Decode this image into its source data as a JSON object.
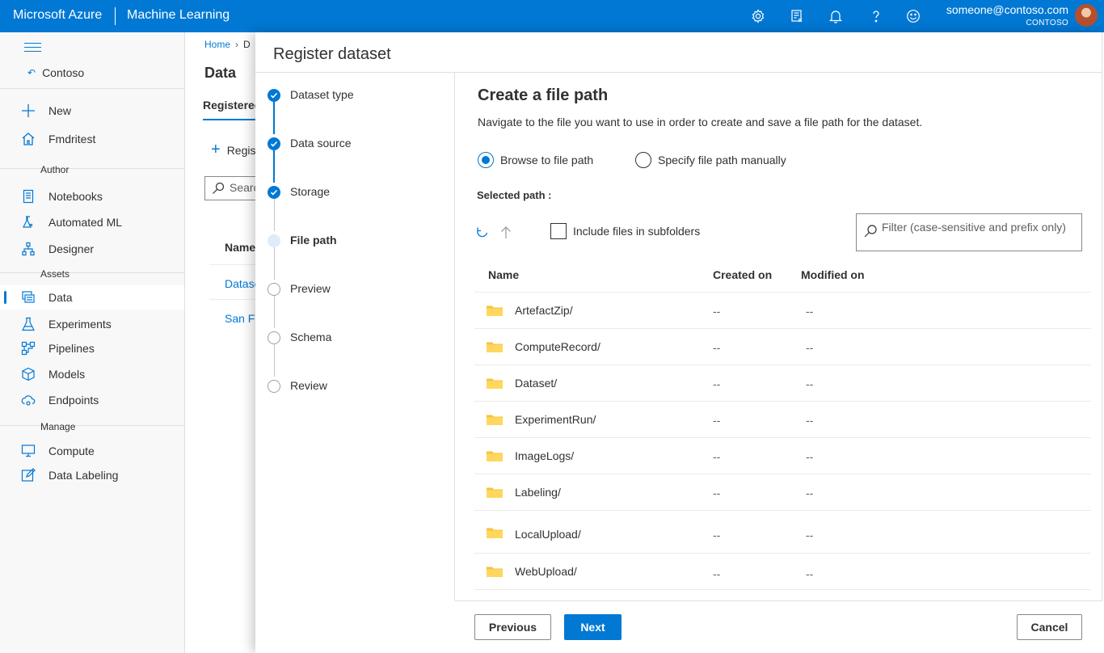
{
  "topbar": {
    "brand": "Microsoft Azure",
    "product": "Machine Learning",
    "icons": [
      "settings-icon",
      "feedback-icon",
      "notifications-icon",
      "help-icon",
      "smiley-icon"
    ],
    "user_email": "someone@contoso.com",
    "user_tenant": "CONTOSO",
    "accent_color": "#0078d4"
  },
  "sidebar": {
    "workspace": "Contoso",
    "top_items": [
      {
        "label": "New",
        "icon": "plus-icon"
      },
      {
        "label": "Fmdritest",
        "icon": "home-icon"
      }
    ],
    "sections": {
      "author": "Author",
      "assets": "Assets",
      "manage": "Manage"
    },
    "author_items": [
      {
        "label": "Notebooks",
        "icon": "notebook-icon"
      },
      {
        "label": "Automated ML",
        "icon": "flask-icon"
      },
      {
        "label": "Designer",
        "icon": "designer-icon"
      }
    ],
    "assets_items": [
      {
        "label": "Data",
        "icon": "data-icon",
        "active": true
      },
      {
        "label": "Experiments",
        "icon": "experiment-icon"
      },
      {
        "label": "Pipelines",
        "icon": "pipeline-icon"
      },
      {
        "label": "Models",
        "icon": "cube-icon"
      },
      {
        "label": "Endpoints",
        "icon": "endpoint-icon"
      }
    ],
    "manage_items": [
      {
        "label": "Compute",
        "icon": "monitor-icon"
      },
      {
        "label": "Data Labeling",
        "icon": "edit-icon"
      }
    ]
  },
  "page": {
    "breadcrumb_home": "Home",
    "breadcrumb_next": "D",
    "title": "Data",
    "tab": "Registered",
    "register_label": "Regis",
    "search_placeholder": "Searc",
    "column_name": "Name",
    "rows": [
      "Datase",
      "San Fr"
    ]
  },
  "panel": {
    "title": "Register dataset",
    "steps": [
      {
        "label": "Dataset type",
        "state": "done"
      },
      {
        "label": "Data source",
        "state": "done"
      },
      {
        "label": "Storage",
        "state": "done"
      },
      {
        "label": "File path",
        "state": "current"
      },
      {
        "label": "Preview",
        "state": "pending"
      },
      {
        "label": "Schema",
        "state": "pending"
      },
      {
        "label": "Review",
        "state": "pending"
      }
    ],
    "content": {
      "title": "Create a file path",
      "description": "Navigate to the file you want to use in order to create and save a file path for the dataset.",
      "radio_browse": "Browse to file path",
      "radio_manual": "Specify file path manually",
      "radio_selected": "browse",
      "selected_path_label": "Selected path :",
      "include_subfolders": "Include files in subfolders",
      "filter_placeholder": "Filter (case-sensitive and prefix only)",
      "columns": {
        "name": "Name",
        "created": "Created on",
        "modified": "Modified on"
      },
      "rows": [
        {
          "name": "ArtefactZip/",
          "created": "--",
          "modified": "--"
        },
        {
          "name": "ComputeRecord/",
          "created": "--",
          "modified": "--"
        },
        {
          "name": "Dataset/",
          "created": "--",
          "modified": "--"
        },
        {
          "name": "ExperimentRun/",
          "created": "--",
          "modified": "--"
        },
        {
          "name": "ImageLogs/",
          "created": "--",
          "modified": "--"
        },
        {
          "name": "Labeling/",
          "created": "--",
          "modified": "--"
        },
        {
          "name": "LocalUpload/",
          "created": "--",
          "modified": "--"
        },
        {
          "name": "WebUpload/",
          "created": "--",
          "modified": "--"
        }
      ]
    },
    "buttons": {
      "previous": "Previous",
      "next": "Next",
      "cancel": "Cancel"
    }
  }
}
